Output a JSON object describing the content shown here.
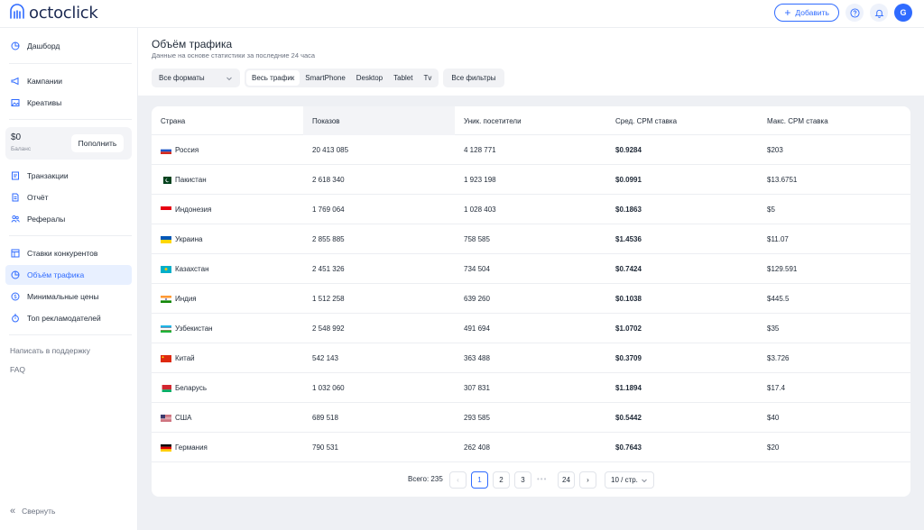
{
  "header": {
    "logo": "octoclick",
    "add_label": "Добавить",
    "avatar_letter": "G"
  },
  "sidebar": {
    "dashboard": "Дашборд",
    "campaigns": "Кампании",
    "creatives": "Креативы",
    "balance_amount": "$0",
    "balance_label": "Баланс",
    "topup": "Пополнить",
    "transactions": "Транзакции",
    "report": "Отчёт",
    "referrals": "Рефералы",
    "competitor_bids": "Ставки конкурентов",
    "traffic_volume": "Объём трафика",
    "min_prices": "Минимальные цены",
    "top_advertisers": "Топ рекламодателей",
    "support": "Написать в поддержку",
    "faq": "FAQ",
    "collapse": "Свернуть"
  },
  "page": {
    "title": "Объём трафика",
    "subtitle": "Данные на основе статистики за последние 24 часа"
  },
  "filters": {
    "format_select": "Все форматы",
    "segments": [
      "Весь трафик",
      "SmartPhone",
      "Desktop",
      "Tablet",
      "Tv"
    ],
    "active_segment": "Весь трафик",
    "all_filters": "Все фильтры"
  },
  "table": {
    "columns": [
      "Страна",
      "Показов",
      "Уник. посетители",
      "Сред. CPM ставка",
      "Макс. CPM ставка"
    ],
    "sorted_column": "Показов",
    "rows": [
      {
        "country": "Россия",
        "flag": "ru",
        "impressions": "20 413 085",
        "unique": "4 128 771",
        "avg_cpm": "$0.9284",
        "max_cpm": "$203"
      },
      {
        "country": "Пакистан",
        "flag": "pk",
        "impressions": "2 618 340",
        "unique": "1 923 198",
        "avg_cpm": "$0.0991",
        "max_cpm": "$13.6751"
      },
      {
        "country": "Индонезия",
        "flag": "id",
        "impressions": "1 769 064",
        "unique": "1 028 403",
        "avg_cpm": "$0.1863",
        "max_cpm": "$5"
      },
      {
        "country": "Украина",
        "flag": "ua",
        "impressions": "2 855 885",
        "unique": "758 585",
        "avg_cpm": "$1.4536",
        "max_cpm": "$11.07"
      },
      {
        "country": "Казахстан",
        "flag": "kz",
        "impressions": "2 451 326",
        "unique": "734 504",
        "avg_cpm": "$0.7424",
        "max_cpm": "$129.591"
      },
      {
        "country": "Индия",
        "flag": "in",
        "impressions": "1 512 258",
        "unique": "639 260",
        "avg_cpm": "$0.1038",
        "max_cpm": "$445.5"
      },
      {
        "country": "Узбекистан",
        "flag": "uz",
        "impressions": "2 548 992",
        "unique": "491 694",
        "avg_cpm": "$1.0702",
        "max_cpm": "$35"
      },
      {
        "country": "Китай",
        "flag": "cn",
        "impressions": "542 143",
        "unique": "363 488",
        "avg_cpm": "$0.3709",
        "max_cpm": "$3.726"
      },
      {
        "country": "Беларусь",
        "flag": "by",
        "impressions": "1 032 060",
        "unique": "307 831",
        "avg_cpm": "$1.1894",
        "max_cpm": "$17.4"
      },
      {
        "country": "США",
        "flag": "us",
        "impressions": "689 518",
        "unique": "293 585",
        "avg_cpm": "$0.5442",
        "max_cpm": "$40"
      },
      {
        "country": "Германия",
        "flag": "de",
        "impressions": "790 531",
        "unique": "262 408",
        "avg_cpm": "$0.7643",
        "max_cpm": "$20"
      }
    ]
  },
  "pagination": {
    "total_label": "Всего: 235",
    "pages": [
      "1",
      "2",
      "3",
      "24"
    ],
    "current": "1",
    "per_page": "10 / стр."
  },
  "colors": {
    "accent": "#2f6bff",
    "bg": "#eef0f4"
  }
}
